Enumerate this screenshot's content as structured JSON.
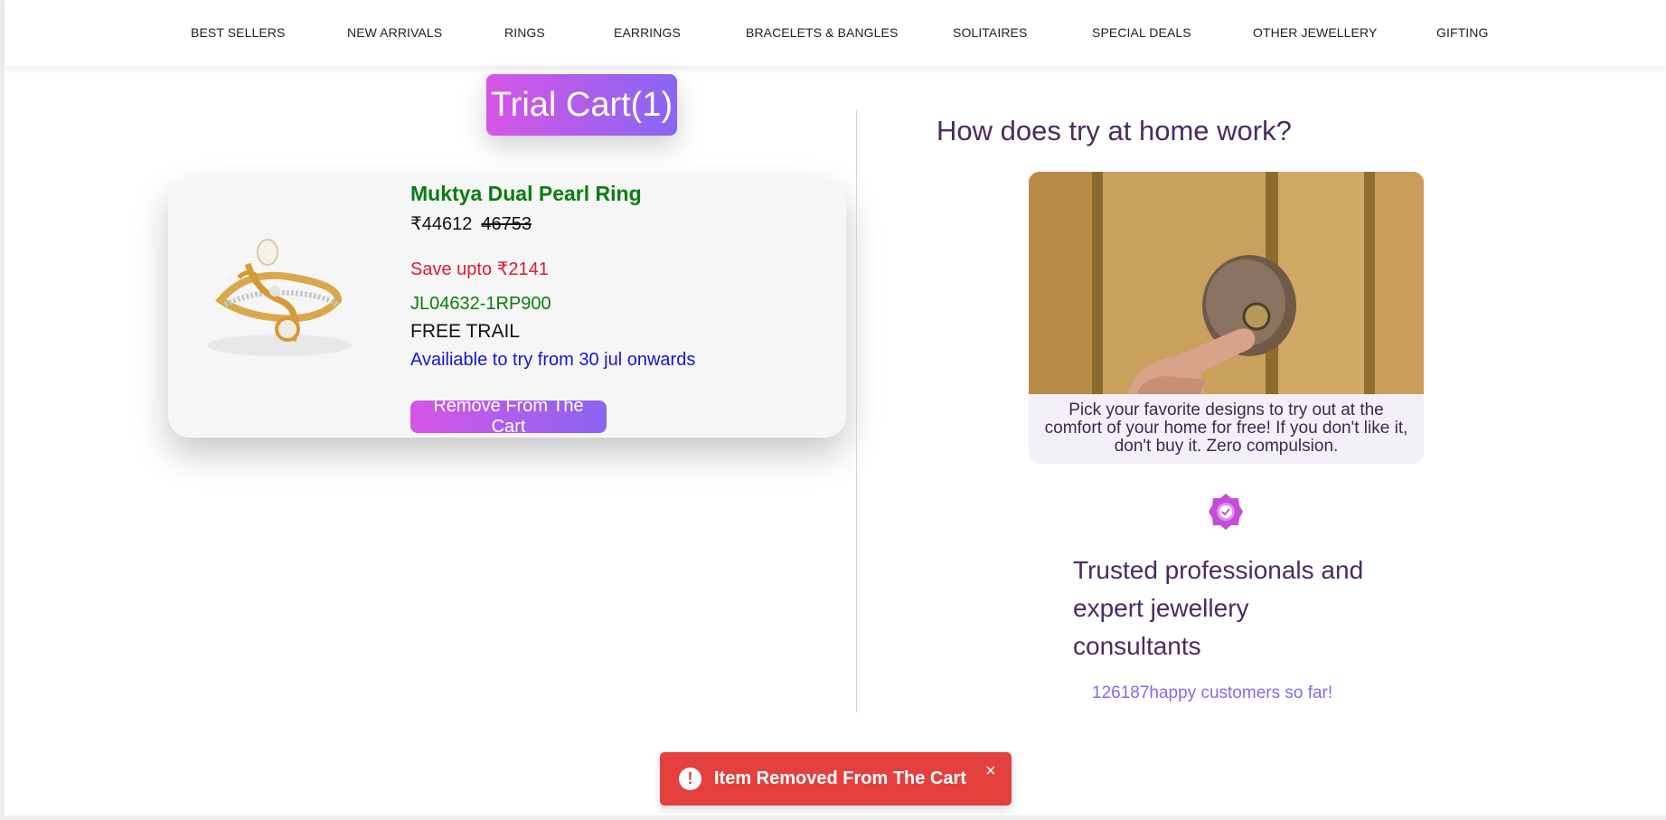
{
  "nav": {
    "items": [
      "BEST SELLERS",
      "NEW ARRIVALS",
      "RINGS",
      "EARRINGS",
      "BRACELETS & BANGLES",
      "SOLITAIRES",
      "SPECIAL DEALS",
      "OTHER JEWELLERY",
      "GIFTING"
    ]
  },
  "cart": {
    "title": "Trial Cart(1)",
    "item": {
      "name": "Muktya Dual Pearl Ring",
      "price": "₹44612",
      "original_price": "46753",
      "savings": "Save upto ₹2141",
      "sku": "JL04632-1RP900",
      "trial_label": "FREE TRAIL",
      "availability": "Availiable to try from 30 jul onwards",
      "remove_label": "Remove From The Cart"
    }
  },
  "info": {
    "title": "How does try at home work?",
    "description": "Pick your favorite designs to try out at the comfort of your home for free! If you don't like it, don't buy it. Zero compulsion.",
    "trusted_text": "Trusted professionals and expert jewellery consultants",
    "happy_count": "126187",
    "happy_suffix": "happy customers so far!"
  },
  "toast": {
    "message": "Item Removed From The Cart",
    "icon": "!",
    "close": "×"
  },
  "colors": {
    "accent_gradient_start": "#d655e6",
    "accent_gradient_end": "#8866f2",
    "product_green": "#0a7c10",
    "save_red": "#dc1b36",
    "availability_blue": "#1515d8",
    "heading_purple": "#4b2a63",
    "toast_red": "#e3403e"
  }
}
